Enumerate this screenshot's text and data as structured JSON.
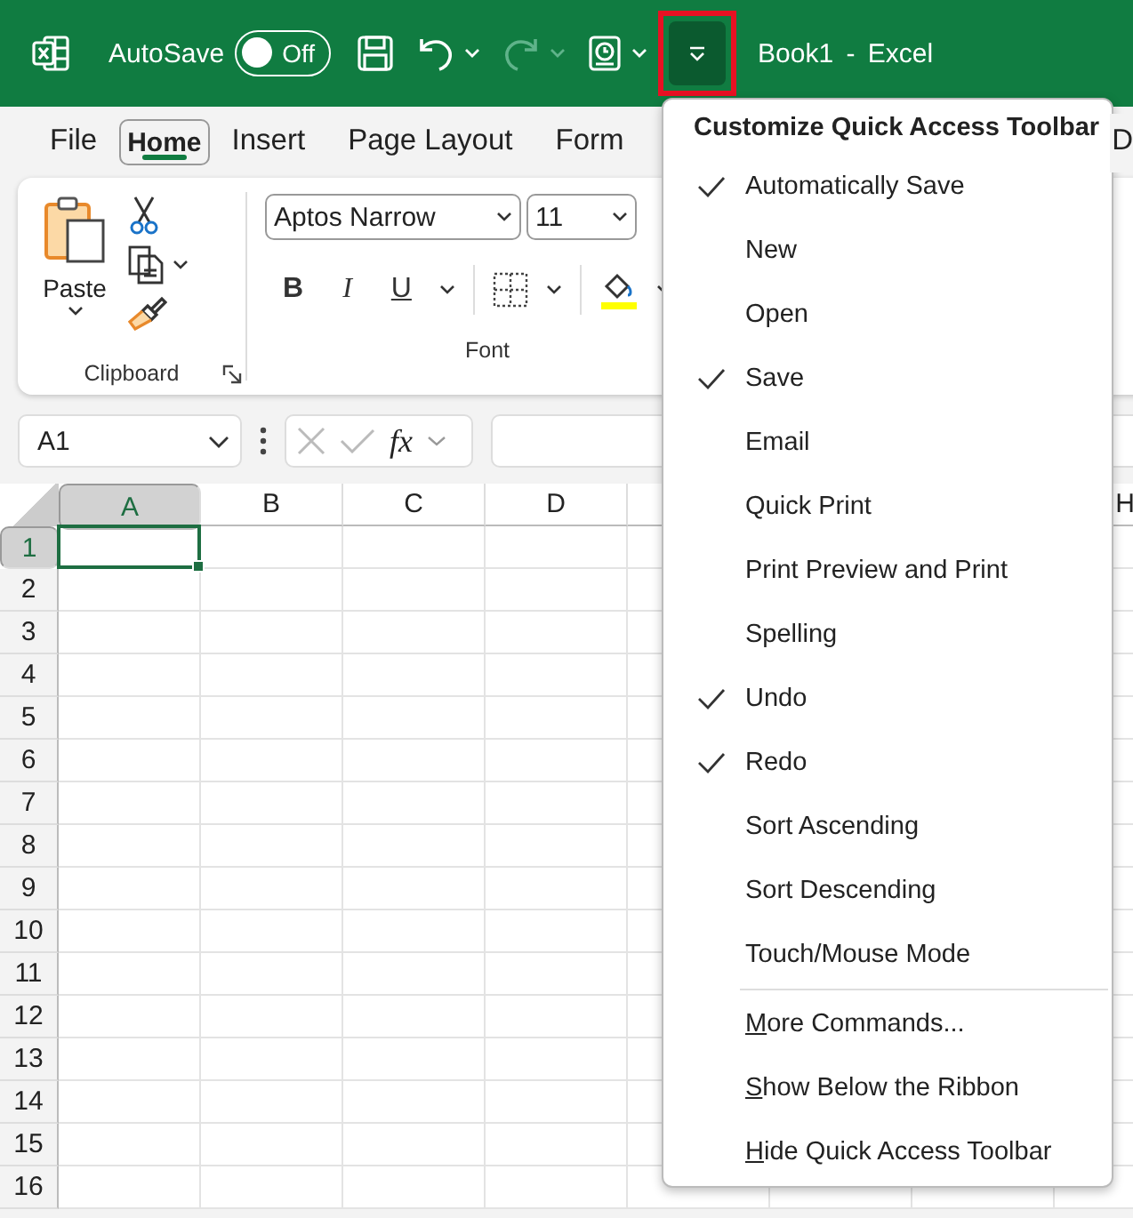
{
  "title_bar": {
    "autosave_label": "AutoSave",
    "autosave": {
      "on": false,
      "text": "Off"
    },
    "quick_access": [
      {
        "kind": "save",
        "disabled": false,
        "dropdown": false
      },
      {
        "kind": "undo",
        "disabled": false,
        "dropdown": true
      },
      {
        "kind": "redo",
        "disabled": true,
        "dropdown": true
      },
      {
        "kind": "touch",
        "disabled": false,
        "dropdown": true
      }
    ],
    "customize_button": {
      "open": true
    },
    "document_title": "Book1 - Excel"
  },
  "tabs": [
    {
      "label": "File",
      "selected": false
    },
    {
      "label": "Home",
      "selected": true
    },
    {
      "label": "Insert",
      "selected": false
    },
    {
      "label": "Page Layout",
      "selected": false
    },
    {
      "label": "Form",
      "selected": false
    },
    {
      "label": "D",
      "selected": false
    }
  ],
  "ribbon": {
    "clipboard": {
      "paste_label": "Paste",
      "label": "Clipboard"
    },
    "font": {
      "font_name": "Aptos Narrow",
      "font_size": "11",
      "style_buttons": [
        "B",
        "I",
        "U"
      ],
      "label": "Font"
    }
  },
  "formula_bar": {
    "name_box": "A1",
    "function_label": "fx"
  },
  "sheet": {
    "columns": [
      {
        "label": "A",
        "selected": true
      },
      {
        "label": "B",
        "selected": false
      },
      {
        "label": "C",
        "selected": false
      },
      {
        "label": "D",
        "selected": false
      },
      {
        "label": "H",
        "selected": false
      }
    ],
    "rows": [
      {
        "label": "1",
        "selected": true
      },
      {
        "label": "2",
        "selected": false
      },
      {
        "label": "3",
        "selected": false
      },
      {
        "label": "4",
        "selected": false
      },
      {
        "label": "5",
        "selected": false
      },
      {
        "label": "6",
        "selected": false
      },
      {
        "label": "7",
        "selected": false
      },
      {
        "label": "8",
        "selected": false
      },
      {
        "label": "9",
        "selected": false
      },
      {
        "label": "10",
        "selected": false
      },
      {
        "label": "11",
        "selected": false
      },
      {
        "label": "12",
        "selected": false
      },
      {
        "label": "13",
        "selected": false
      },
      {
        "label": "14",
        "selected": false
      },
      {
        "label": "15",
        "selected": false
      },
      {
        "label": "16",
        "selected": false
      }
    ]
  },
  "menu": {
    "title": "Customize Quick Access Toolbar",
    "items": [
      {
        "label": "Automatically Save",
        "checked": true
      },
      {
        "label": "New",
        "checked": false
      },
      {
        "label": "Open",
        "checked": false
      },
      {
        "label": "Save",
        "checked": true
      },
      {
        "label": "Email",
        "checked": false
      },
      {
        "label": "Quick Print",
        "checked": false
      },
      {
        "label": "Print Preview and Print",
        "checked": false
      },
      {
        "label": "Spelling",
        "checked": false
      },
      {
        "label": "Undo",
        "checked": true
      },
      {
        "label": "Redo",
        "checked": true
      },
      {
        "label": "Sort Ascending",
        "checked": false
      },
      {
        "label": "Sort Descending",
        "checked": false
      },
      {
        "label": "Touch/Mouse Mode",
        "checked": false
      }
    ],
    "footer_items": [
      {
        "label": "More Commands...",
        "underline_first": true
      },
      {
        "label": "Show Below the Ribbon",
        "underline_first": true
      },
      {
        "label": "Hide Quick Access Toolbar",
        "underline_first": true
      }
    ]
  }
}
